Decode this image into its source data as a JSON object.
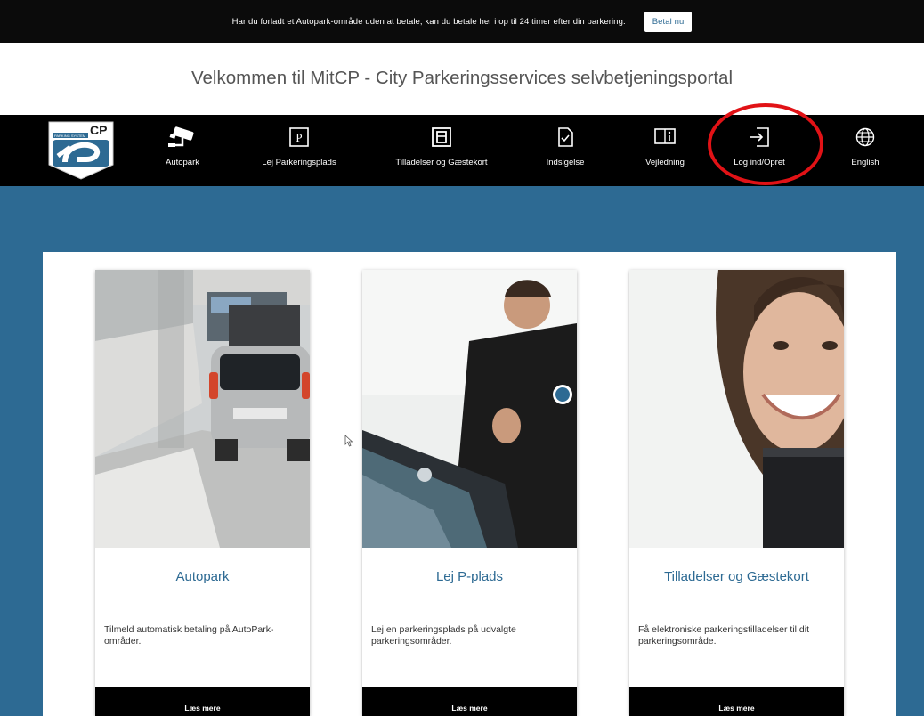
{
  "topbar": {
    "message": "Har du forladt et Autopark-område uden at betale, kan du betale her i op til 24 timer efter din parkering.",
    "pay_button": "Betal nu"
  },
  "welcome_title": "Velkommen til MitCP - City Parkeringsservices selvbetjeningsportal",
  "logo": {
    "cp_text": "CP",
    "band_text": "PARKING SYSTEM"
  },
  "nav": {
    "items": [
      {
        "label": "Autopark",
        "icon": "camera-icon"
      },
      {
        "label": "Lej Parkeringsplads",
        "icon": "parking-sign-icon"
      },
      {
        "label": "Tilladelser og Gæstekort",
        "icon": "permit-card-icon"
      },
      {
        "label": "Indsigelse",
        "icon": "document-check-icon"
      },
      {
        "label": "Vejledning",
        "icon": "guide-book-icon"
      },
      {
        "label": "Log ind/Opret",
        "icon": "login-icon"
      },
      {
        "label": "English",
        "icon": "globe-icon"
      }
    ]
  },
  "cards": [
    {
      "title": "Autopark",
      "description": "Tilmeld automatisk betaling på AutoPark-områder.",
      "button": "Læs mere"
    },
    {
      "title": "Lej P-plads",
      "description": "Lej en parkeringsplads på udvalgte parkeringsområder.",
      "button": "Læs mere"
    },
    {
      "title": "Tilladelser og Gæstekort",
      "description": "Få elektroniske parkeringstilladelser til dit parkeringsområde.",
      "button": "Læs mere"
    }
  ],
  "colors": {
    "brand_blue": "#2d6a93",
    "nav_background": "#000000",
    "highlight_ring": "#e11216"
  }
}
